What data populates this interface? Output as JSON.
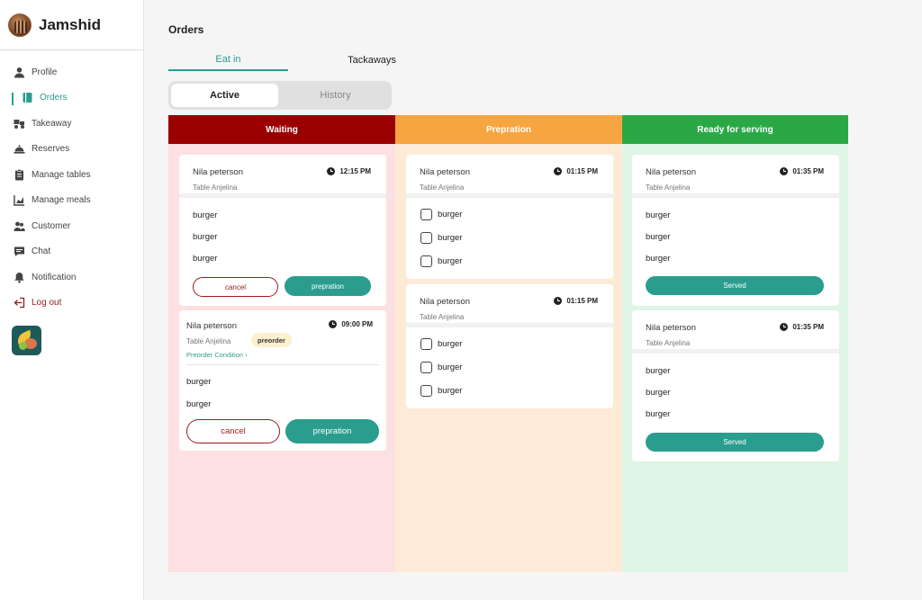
{
  "user": {
    "name": "Jamshid"
  },
  "nav": [
    {
      "label": "Profile",
      "icon": "person-icon"
    },
    {
      "label": "Orders",
      "icon": "book-icon",
      "active": true
    },
    {
      "label": "Takeaway",
      "icon": "delivery-icon"
    },
    {
      "label": "Reserves",
      "icon": "cloche-icon"
    },
    {
      "label": "Manage tables",
      "icon": "clipboard-icon"
    },
    {
      "label": "Manage meals",
      "icon": "chart-icon"
    },
    {
      "label": "Customer",
      "icon": "users-icon"
    },
    {
      "label": "Chat",
      "icon": "chat-icon"
    },
    {
      "label": "Notification",
      "icon": "bell-icon"
    },
    {
      "label": "Log out",
      "icon": "logout-icon"
    }
  ],
  "page": {
    "title": "Orders"
  },
  "tabs": {
    "eat_in": "Eat in",
    "takeaways": "Tackaways"
  },
  "segment": {
    "active": "Active",
    "history": "History"
  },
  "columns": {
    "waiting": {
      "title": "Waiting",
      "color": "#9a0000",
      "cards": [
        {
          "name": "Nila peterson",
          "table": "Table Anjelina",
          "time": "12:15 PM",
          "items": [
            "burger",
            "burger",
            "burger"
          ],
          "cancel": "cancel",
          "action": "prepration"
        },
        {
          "name": "Nila peterson",
          "table": "Table Anjelina",
          "time": "09:00 PM",
          "badge": "preorder",
          "condition": "Preorder Condition",
          "items": [
            "burger",
            "burger"
          ],
          "cancel": "cancel",
          "action": "prepration"
        }
      ]
    },
    "preparation": {
      "title": "Prepration",
      "color": "#f7a540",
      "cards": [
        {
          "name": "Nila peterson",
          "table": "Table Anjelina",
          "time": "01:15 PM",
          "items": [
            "burger",
            "burger",
            "burger"
          ]
        },
        {
          "name": "Nila peterson",
          "table": "Table Anjelina",
          "time": "01:15 PM",
          "items": [
            "burger",
            "burger",
            "burger"
          ]
        }
      ]
    },
    "ready": {
      "title": "Ready for serving",
      "color": "#2aa846",
      "cards": [
        {
          "name": "Nila peterson",
          "table": "Table Anjelina",
          "time": "01:35 PM",
          "items": [
            "burger",
            "burger",
            "burger"
          ],
          "action": "Served"
        },
        {
          "name": "Nila peterson",
          "table": "Table Anjelina",
          "time": "01:35 PM",
          "items": [
            "burger",
            "burger",
            "burger"
          ],
          "action": "Served"
        }
      ]
    }
  }
}
